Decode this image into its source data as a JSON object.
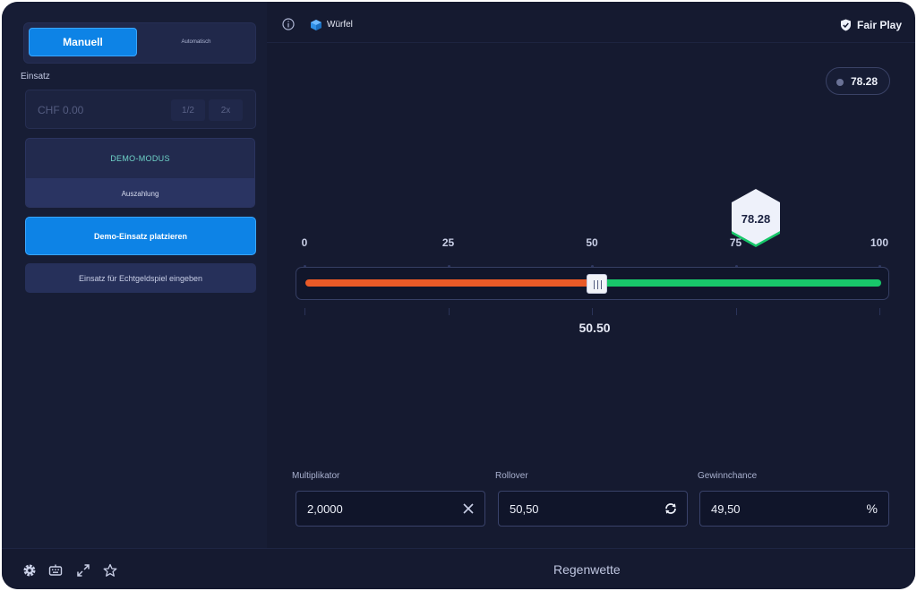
{
  "mode": {
    "manual": "Manuell",
    "auto": "Automatisch"
  },
  "stake": {
    "label": "Einsatz",
    "value": "CHF 0.00",
    "half": "1/2",
    "double": "2x"
  },
  "demo": {
    "title": "DEMO-MODUS",
    "payout_label": "Auszahlung"
  },
  "actions": {
    "place_demo": "Demo-Einsatz platzieren",
    "real_play": "Einsatz für Echtgeldspiel eingeben"
  },
  "header": {
    "game": "Würfel",
    "fair_play": "Fair Play"
  },
  "last_result": "78.28",
  "slider": {
    "ticks": [
      "0",
      "25",
      "50",
      "75",
      "100"
    ],
    "value": 50.5,
    "value_label": "50.50",
    "roll_result": 78.28,
    "roll_label": "78.28",
    "colors": {
      "lose": "#ea5a27",
      "win": "#18c76a"
    }
  },
  "fields": {
    "multiplier": {
      "label": "Multiplikator",
      "value": "2,0000"
    },
    "rollover": {
      "label": "Rollover",
      "value": "50,50"
    },
    "win_chance": {
      "label": "Gewinnchance",
      "value": "49,50",
      "unit": "%"
    }
  },
  "footer": {
    "title": "Regenwette"
  },
  "icons": [
    "info-icon",
    "cube-icon",
    "shield-check-icon",
    "settings-icon",
    "keyboard-icon",
    "expand-icon",
    "star-icon",
    "close-icon",
    "refresh-icon"
  ],
  "colors": {
    "accent": "#0d83e6",
    "background": "#151a30"
  }
}
